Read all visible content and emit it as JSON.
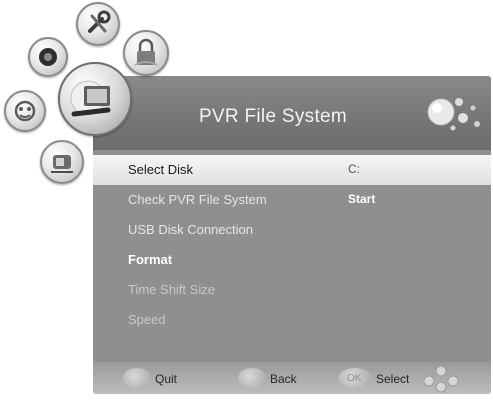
{
  "panel": {
    "title": "PVR File System"
  },
  "menu": {
    "items": [
      {
        "label": "Select Disk",
        "value": "C:"
      },
      {
        "label": "Check PVR File System",
        "value": "Start"
      },
      {
        "label": "USB Disk Connection",
        "value": ""
      },
      {
        "label": "Format",
        "value": ""
      },
      {
        "label": "Time Shift Size",
        "value": ""
      },
      {
        "label": "Speed",
        "value": ""
      }
    ]
  },
  "footer": {
    "quit_label": "Quit",
    "back_label": "Back",
    "ok_label": "OK",
    "select_label": "Select"
  },
  "side_icons": [
    "settings-tools-icon",
    "lock-icon",
    "speaker-icon",
    "picture-icon",
    "clock-icon",
    "pvr-disk-icon"
  ]
}
